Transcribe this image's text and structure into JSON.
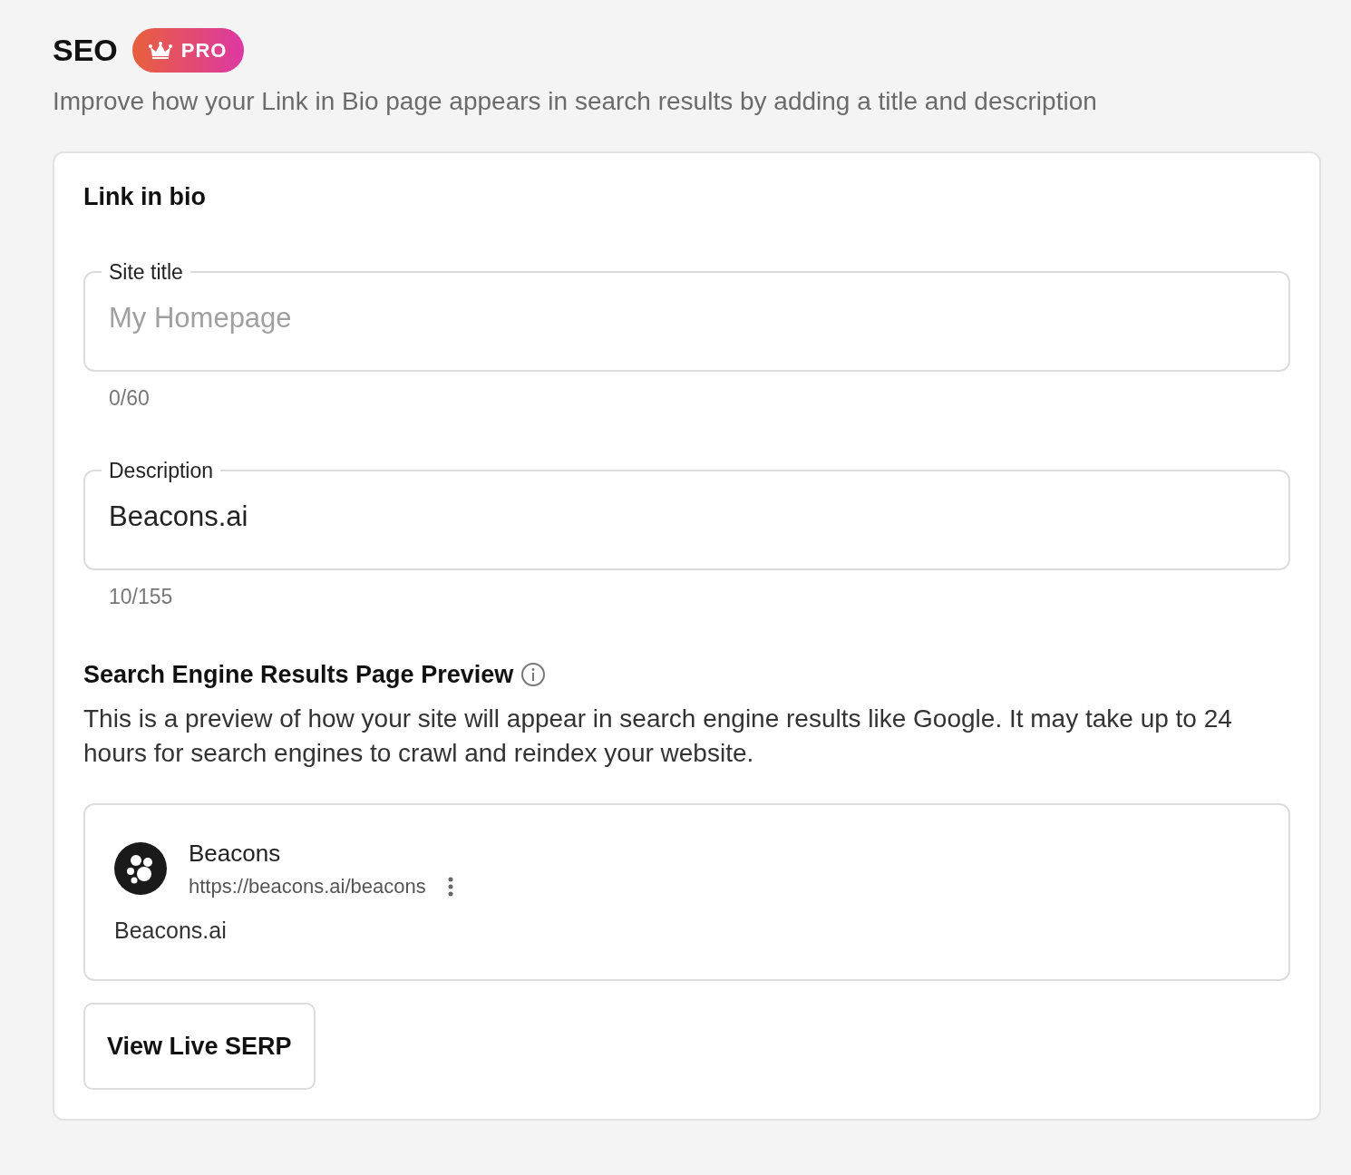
{
  "header": {
    "title": "SEO",
    "badge": "PRO",
    "subtitle": "Improve how your Link in Bio page appears in search results by adding a title and description"
  },
  "card": {
    "title": "Link in bio",
    "fields": [
      {
        "label": "Site title",
        "placeholder": "My Homepage",
        "counter": "0/60"
      },
      {
        "label": "Description",
        "value": "Beacons.ai",
        "counter": "10/155"
      }
    ],
    "preview": {
      "heading": "Search Engine Results Page Preview",
      "text": "This is a preview of how your site will appear in search engine results like Google. It may take up to 24 hours for search engines to crawl and reindex your website.",
      "result": {
        "site_name": "Beacons",
        "url": "https://beacons.ai/beacons",
        "description": "Beacons.ai"
      }
    },
    "button": "View Live SERP"
  }
}
